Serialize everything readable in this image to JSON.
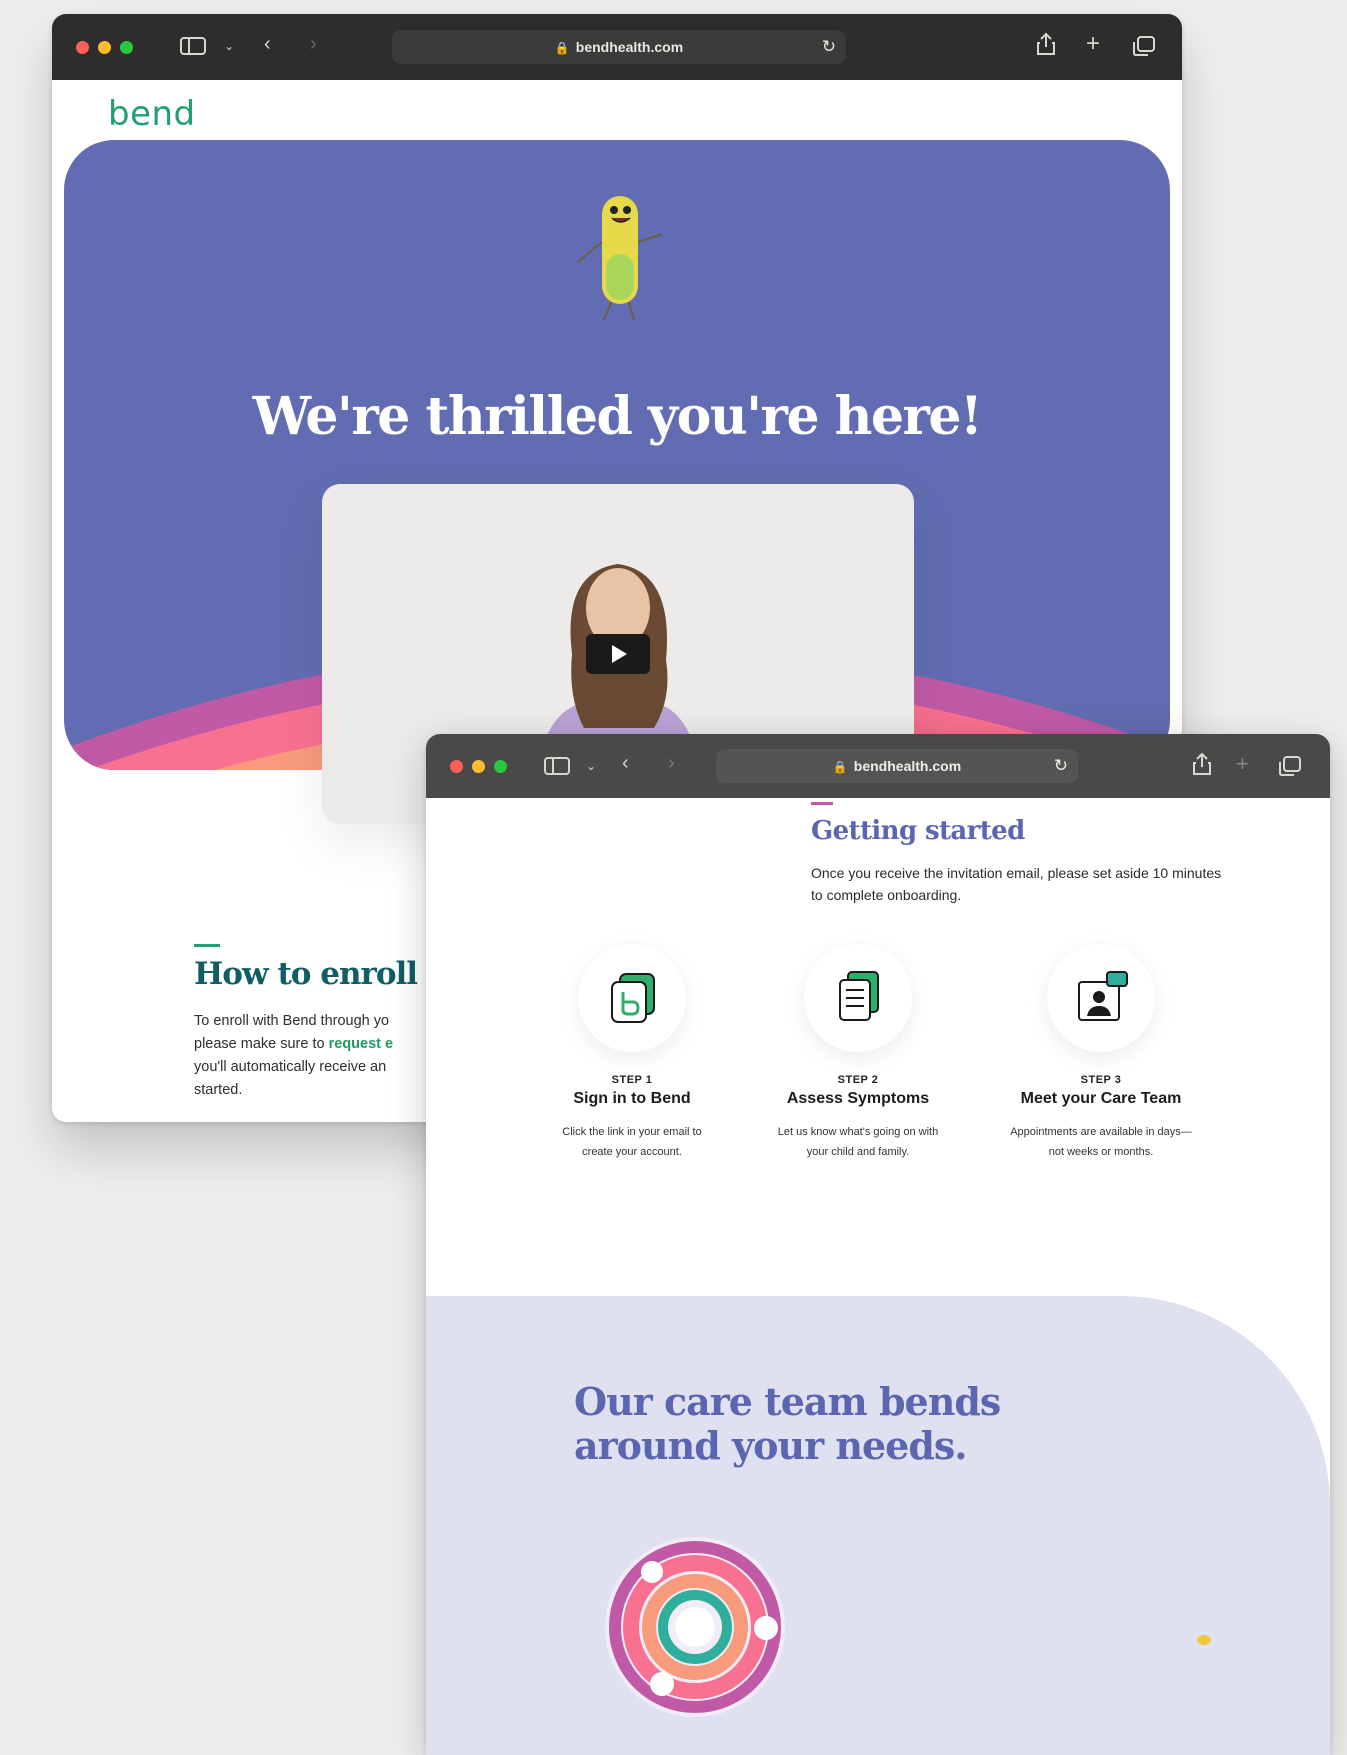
{
  "browser_back": {
    "url": "bendhealth.com"
  },
  "browser_front": {
    "url": "bendhealth.com"
  },
  "logo": "bend",
  "hero": {
    "title": "We're thrilled you're here!"
  },
  "enroll": {
    "title": "How to enroll",
    "text_line1": "To enroll with Bend through yo",
    "text_line2_prefix": "please make sure to ",
    "text_line2_link": "request e",
    "text_line3": "you'll automatically receive an",
    "text_line4": "started."
  },
  "getting_started": {
    "title": "Getting started",
    "text": "Once you receive the invitation email, please set aside 10 minutes to complete onboarding."
  },
  "steps": [
    {
      "num": "STEP 1",
      "name": "Sign in to Bend",
      "desc_line1": "Click the link in your email to",
      "desc_line2": "create your account."
    },
    {
      "num": "STEP 2",
      "name": "Assess Symptoms",
      "desc_line1": "Let us know what's going on with",
      "desc_line2": "your child and family."
    },
    {
      "num": "STEP 3",
      "name": "Meet your Care Team",
      "desc_line1": "Appointments are available in days—",
      "desc_line2": "not weeks or months."
    }
  ],
  "care": {
    "title_line1": "Our care team bends",
    "title_line2": "around your needs."
  },
  "colors": {
    "brand_green": "#21a06f",
    "hero_purple": "#626cb2",
    "heading_blue": "#5b66b0",
    "heading_teal": "#0f5e63",
    "care_bg": "#dfe1f1"
  }
}
